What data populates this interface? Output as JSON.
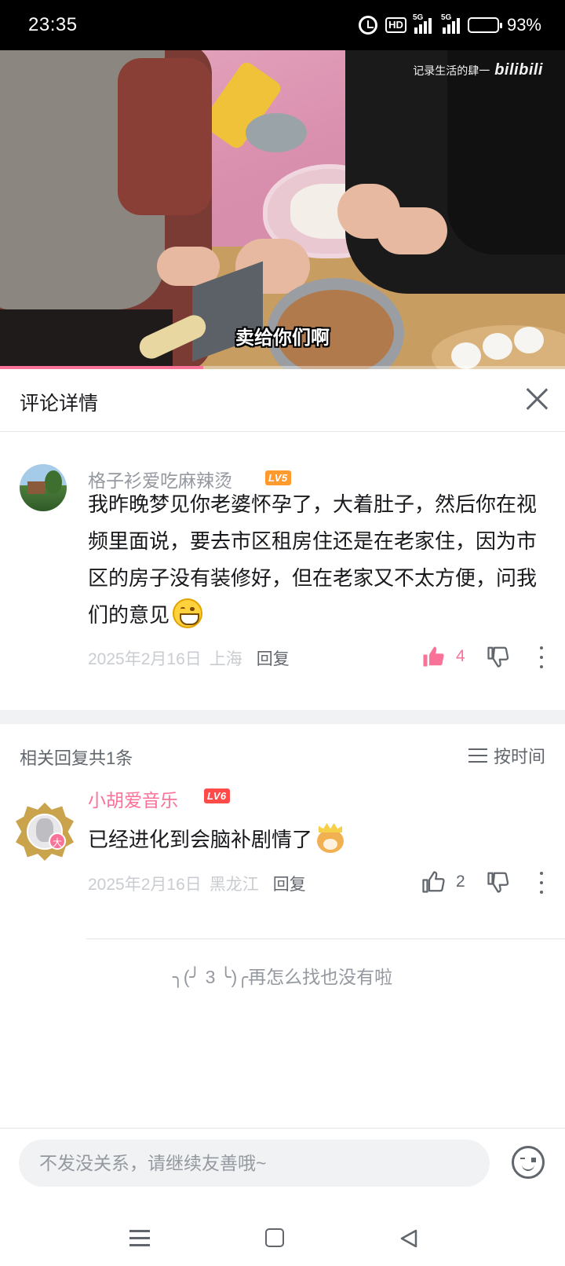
{
  "status_bar": {
    "time": "23:35",
    "network_1": "5G",
    "network_2": "5G",
    "hd_label": "HD",
    "battery_percent": "93%",
    "battery_level": 0.93,
    "icons": [
      "alarm-icon",
      "hd-icon",
      "signal-icon",
      "signal-icon",
      "battery-icon"
    ]
  },
  "video": {
    "watermark_text": "记录生活的肆一",
    "watermark_brand": "bilibili",
    "subtitle": "卖给你们啊",
    "progress": 0.36,
    "accent_color": "#fb7299"
  },
  "panel": {
    "title": "评论详情",
    "close_icon": "close-icon"
  },
  "main_comment": {
    "username": "格子衫爱吃麻辣烫",
    "level": "LV5",
    "text": "我昨晚梦见你老婆怀孕了，大着肚子，然后你在视频里面说，要去市区租房住还是在老家住，因为市区的房子没有装修好，但在老家又不太方便，问我们的意见",
    "emoji": "grin-emoji",
    "date": "2025年2月16日",
    "location": "上海",
    "reply_label": "回复",
    "likes": "4",
    "liked": true
  },
  "replies_section": {
    "count_label": "相关回复共1条",
    "sort_label": "按时间"
  },
  "reply": {
    "username": "小胡爱音乐",
    "level": "LV6",
    "avatar_tag": "大",
    "text": "已经进化到会脑补剧情了",
    "emoji": "doge-emoji",
    "date": "2025年2月16日",
    "location": "黑龙江",
    "reply_label": "回复",
    "likes": "2"
  },
  "end_note": "╮(╯ 3 ╰)╭再怎么找也没有啦",
  "input": {
    "placeholder": "不发没关系，请继续友善哦~"
  },
  "nav": [
    "menu-icon",
    "home-icon",
    "back-icon"
  ]
}
